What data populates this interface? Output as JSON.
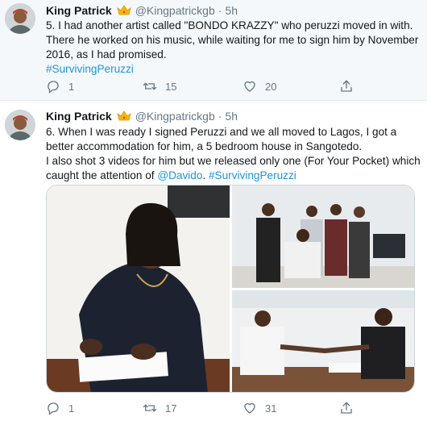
{
  "tweets": [
    {
      "author": "King Patrick",
      "handle": "@Kingpatrickgb",
      "time": "5h",
      "text": "5. I had another artist called \"BONDO KRAZZY\" who peruzzi moved in with. There he worked on his music, while waiting for me to sign him by November 2016, as I had promised.",
      "hashtag": "#SurvivingPeruzzi",
      "replies": "1",
      "retweets": "15",
      "likes": "20"
    },
    {
      "author": "King Patrick",
      "handle": "@Kingpatrickgb",
      "time": "5h",
      "text_line1": "6. When I was ready I signed Peruzzi and we all moved to Lagos, I got a better accommodation for him, a 5 bedroom house in Sangotedo.",
      "text_line2": "I also shot 3 videos for him but we released only one (For Your Pocket) which caught the attention of",
      "mention": "@Davido",
      "after_mention": ".",
      "hashtag": "#SurvivingPeruzzi",
      "replies": "1",
      "retweets": "17",
      "likes": "31"
    }
  ],
  "icons": {
    "crown": "crown-emoji",
    "reply": "reply-icon",
    "retweet": "retweet-icon",
    "like": "heart-icon",
    "share": "share-icon"
  },
  "colors": {
    "link": "#1b95e0",
    "secondary": "#657786",
    "highlight_bg": "#f5f8fa"
  }
}
